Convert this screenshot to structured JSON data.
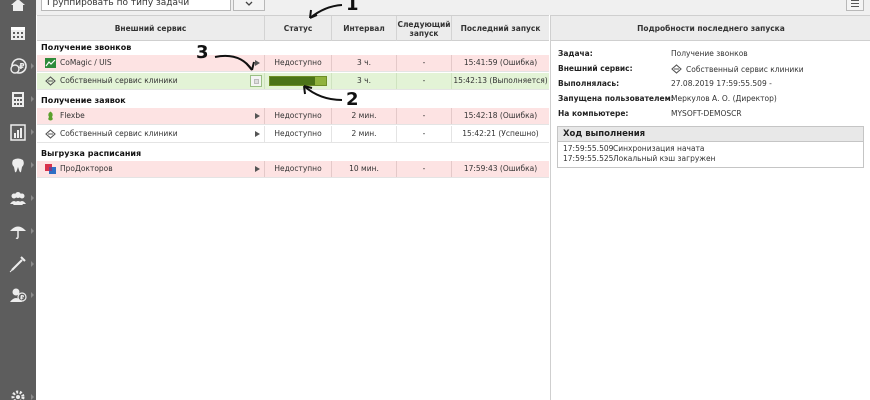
{
  "toolbar": {
    "group_by_value": "Группировать по типу задачи"
  },
  "sidebar": {
    "icons": [
      "home-icon",
      "calendar-icon",
      "ruble-coin-icon",
      "calculator-icon",
      "report-chart-icon",
      "tooth-icon",
      "users-icon",
      "umbrella-icon",
      "syringe-icon",
      "user-ruble-icon",
      "settings-gear-icon"
    ]
  },
  "grid": {
    "headers": {
      "service": "Внешний сервис",
      "status": "Статус",
      "interval": "Интервал",
      "next_run": "Следующий запуск",
      "last_run": "Последний запуск"
    },
    "groups": [
      {
        "title": "Получение звонков",
        "rows": [
          {
            "service": "CoMagic / UIS",
            "icon": "comagic-icon",
            "status": "Недоступно",
            "interval": "3 ч.",
            "next": "-",
            "last": "15:41:59 (Ошибка)",
            "state": "error"
          },
          {
            "service": "Собственный сервис клиники",
            "icon": "diamond-arrows-icon",
            "status": "",
            "progress": 0.8,
            "interval": "3 ч.",
            "next": "-",
            "last": "15:42:13 (Выполняется)",
            "state": "running"
          }
        ]
      },
      {
        "title": "Получение заявок",
        "rows": [
          {
            "service": "Flexbe",
            "icon": "flexbe-icon",
            "status": "Недоступно",
            "interval": "2 мин.",
            "next": "-",
            "last": "15:42:18 (Ошибка)",
            "state": "error"
          },
          {
            "service": "Собственный сервис клиники",
            "icon": "diamond-arrows-icon",
            "status": "Недоступно",
            "interval": "2 мин.",
            "next": "-",
            "last": "15:42:21 (Успешно)",
            "state": "ok"
          }
        ]
      },
      {
        "title": "Выгрузка расписания",
        "rows": [
          {
            "service": "ПроДокторов",
            "icon": "prodoctorov-icon",
            "status": "Недоступно",
            "interval": "10 мин.",
            "next": "-",
            "last": "17:59:43 (Ошибка)",
            "state": "error"
          }
        ]
      }
    ]
  },
  "details": {
    "title": "Подробности последнего запуска",
    "fields": [
      {
        "label": "Задача:",
        "value": "Получение звонков"
      },
      {
        "label": "Внешний сервис:",
        "value": "Собственный сервис клиники"
      },
      {
        "label": "Выполнялась:",
        "value": "27.08.2019 17:59:55.509 -"
      },
      {
        "label": "Запущена пользователем:",
        "value": "Меркулов А. О. (Директор)"
      },
      {
        "label": "На компьютере:",
        "value": "MYSOFT-DEMOSCR"
      }
    ],
    "progress_title": "Ход выполнения",
    "log": [
      {
        "time": "17:59:55.509",
        "text": "Синхронизация начата"
      },
      {
        "time": "17:59:55.525",
        "text": "Локальный кэш загружен"
      }
    ]
  },
  "annotations": [
    "1",
    "2",
    "3"
  ],
  "colors": {
    "sidebar": "#5d5d5d",
    "row_error": "#fde3e3",
    "row_running": "#e3f3d6",
    "progress": "#4b7318"
  }
}
